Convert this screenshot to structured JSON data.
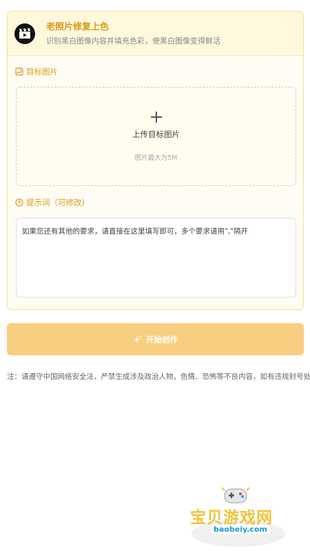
{
  "header": {
    "title": "老照片修复上色",
    "subtitle": "识别黑白图像内容并填充色彩，使黑白图像变得鲜活",
    "icon": "movie-clapper-icon"
  },
  "target_image": {
    "label": "目标图片",
    "upload_label": "上传目标图片",
    "upload_hint": "图片最大为5M"
  },
  "prompt": {
    "label": "提示词（可修改)",
    "value": "如果您还有其他的要求，请直接在这里填写即可，多个要求请用\",\"隔开"
  },
  "actions": {
    "create_label": "开始创作"
  },
  "notice": "注：请遵守中国网络安全法，严禁生成涉及政治人物，色情、恐怖等不良内容，如有违规封号处理!",
  "watermark": {
    "title": "宝贝游戏网",
    "url": "baobeiy.com"
  },
  "colors": {
    "accent": "#d99a1c",
    "button": "#f8cf80",
    "card_border": "#f4e08a"
  }
}
